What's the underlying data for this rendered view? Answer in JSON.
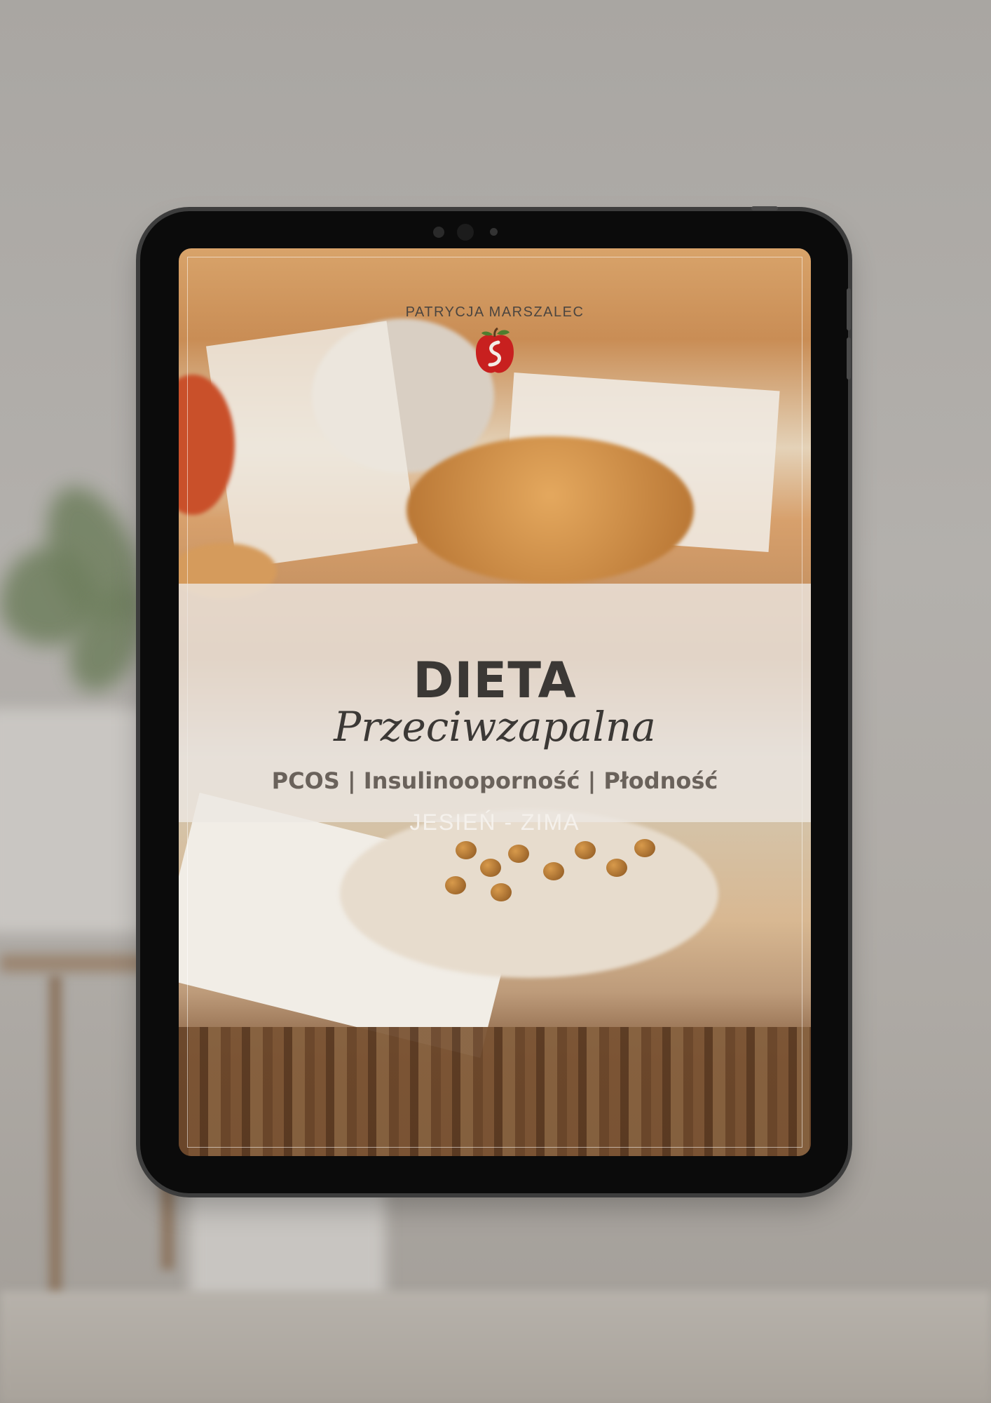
{
  "cover": {
    "author": "PATRYCJA MARSZALEC",
    "logo_icon": "apple-logo-icon",
    "title": "DIETA",
    "subtitle": "Przeciwzapalna",
    "tags": "PCOS | Insulinooporność | Płodność",
    "season": "JESIEŃ - ZIMA"
  },
  "colors": {
    "tablet_body": "#0b0b0b",
    "band": "#ece7e2",
    "title_text": "#3b3835",
    "tags_text": "#6a625b",
    "logo_red": "#c8201f"
  }
}
